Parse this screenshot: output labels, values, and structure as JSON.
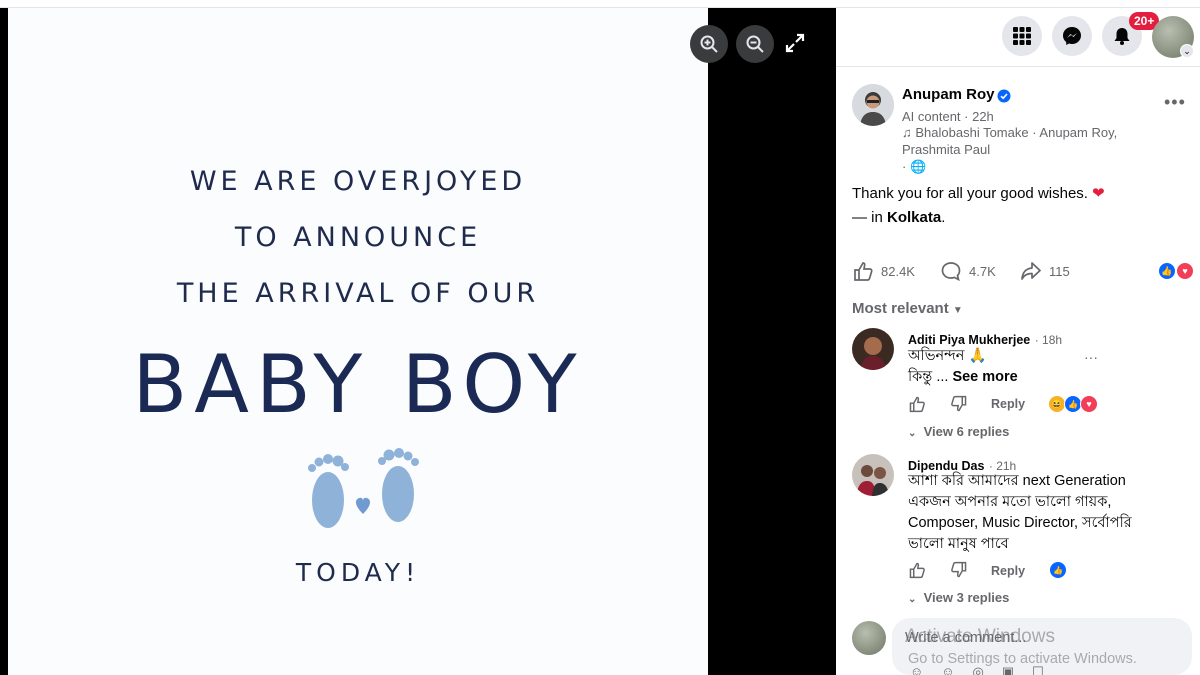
{
  "photo": {
    "line1": "WE ARE OVERJOYED",
    "line2": "TO ANNOUNCE",
    "line3": "THE ARRIVAL OF OUR",
    "headline": "BABY BOY",
    "line4": "TODAY!",
    "footprints_icon": "baby-footprints-heart-icon"
  },
  "viewer_controls": [
    "zoom-in-icon",
    "zoom-out-icon",
    "fullscreen-icon"
  ],
  "header": {
    "icons": [
      "menu-grid-icon",
      "messenger-icon",
      "bell-icon"
    ],
    "notification_badge": "20+"
  },
  "post": {
    "author": "Anupam Roy",
    "verified": true,
    "meta": "AI content · 22h",
    "music_line1": "Bhalobashi Tomake · Anupam Roy,",
    "music_line2": "Prashmita Paul",
    "privacy_dot": "·",
    "caption": "Thank you for all your good wishes.",
    "location_prefix": "— in ",
    "location": "Kolkata",
    "location_suffix": ".",
    "likes": "82.4K",
    "comments": "4.7K",
    "shares": "115"
  },
  "sort_label": "Most relevant",
  "comments": [
    {
      "name": "Aditi Piya Mukherjee",
      "time": "· 18h",
      "line1": "অভিনন্দন 🙏",
      "line2_text": "কিন্তু ... ",
      "see_more": "See more",
      "reply_label": "Reply",
      "replies": "View 6 replies"
    },
    {
      "name": "Dipendu Das",
      "time": "· 21h",
      "line1": "আশা করি আমাদের next Generation",
      "line2": "একজন অপনার মতো ভালো গায়ক,",
      "line3": "Composer, Music Director, সর্বোপরি",
      "line4": "ভালো মানুষ পাবে",
      "reply_label": "Reply",
      "replies": "View 3 replies"
    }
  ],
  "composer": {
    "placeholder": "Write a comment..."
  },
  "watermark": {
    "line1": "Activate Windows",
    "line2": "Go to Settings to activate Windows."
  },
  "colors": {
    "accent": "#0866ff",
    "badge": "#e41e3f",
    "navy_text": "#1f2b4d"
  }
}
